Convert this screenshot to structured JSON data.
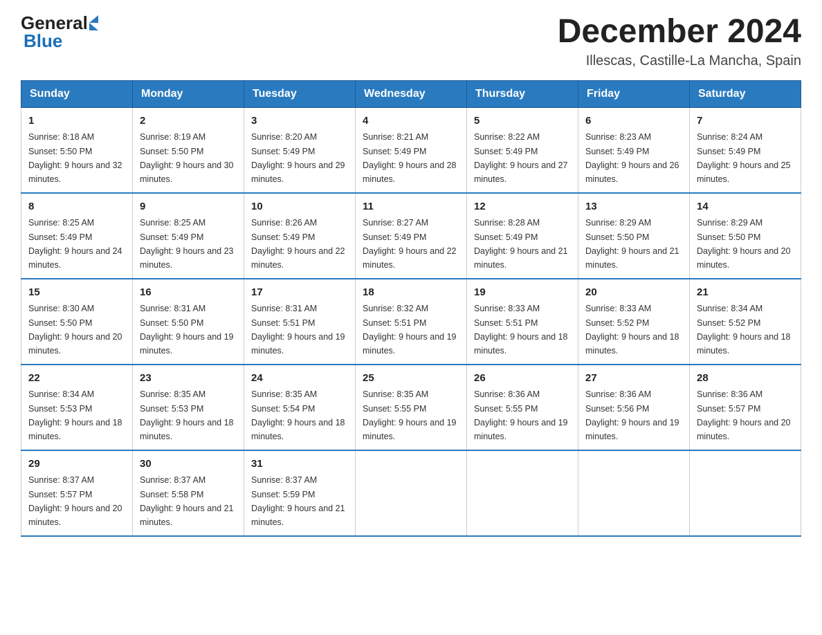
{
  "header": {
    "logo": {
      "text_general": "General",
      "text_blue": "Blue"
    },
    "title": "December 2024",
    "subtitle": "Illescas, Castille-La Mancha, Spain"
  },
  "days_of_week": [
    "Sunday",
    "Monday",
    "Tuesday",
    "Wednesday",
    "Thursday",
    "Friday",
    "Saturday"
  ],
  "weeks": [
    [
      {
        "day": "1",
        "sunrise": "8:18 AM",
        "sunset": "5:50 PM",
        "daylight": "9 hours and 32 minutes."
      },
      {
        "day": "2",
        "sunrise": "8:19 AM",
        "sunset": "5:50 PM",
        "daylight": "9 hours and 30 minutes."
      },
      {
        "day": "3",
        "sunrise": "8:20 AM",
        "sunset": "5:49 PM",
        "daylight": "9 hours and 29 minutes."
      },
      {
        "day": "4",
        "sunrise": "8:21 AM",
        "sunset": "5:49 PM",
        "daylight": "9 hours and 28 minutes."
      },
      {
        "day": "5",
        "sunrise": "8:22 AM",
        "sunset": "5:49 PM",
        "daylight": "9 hours and 27 minutes."
      },
      {
        "day": "6",
        "sunrise": "8:23 AM",
        "sunset": "5:49 PM",
        "daylight": "9 hours and 26 minutes."
      },
      {
        "day": "7",
        "sunrise": "8:24 AM",
        "sunset": "5:49 PM",
        "daylight": "9 hours and 25 minutes."
      }
    ],
    [
      {
        "day": "8",
        "sunrise": "8:25 AM",
        "sunset": "5:49 PM",
        "daylight": "9 hours and 24 minutes."
      },
      {
        "day": "9",
        "sunrise": "8:25 AM",
        "sunset": "5:49 PM",
        "daylight": "9 hours and 23 minutes."
      },
      {
        "day": "10",
        "sunrise": "8:26 AM",
        "sunset": "5:49 PM",
        "daylight": "9 hours and 22 minutes."
      },
      {
        "day": "11",
        "sunrise": "8:27 AM",
        "sunset": "5:49 PM",
        "daylight": "9 hours and 22 minutes."
      },
      {
        "day": "12",
        "sunrise": "8:28 AM",
        "sunset": "5:49 PM",
        "daylight": "9 hours and 21 minutes."
      },
      {
        "day": "13",
        "sunrise": "8:29 AM",
        "sunset": "5:50 PM",
        "daylight": "9 hours and 21 minutes."
      },
      {
        "day": "14",
        "sunrise": "8:29 AM",
        "sunset": "5:50 PM",
        "daylight": "9 hours and 20 minutes."
      }
    ],
    [
      {
        "day": "15",
        "sunrise": "8:30 AM",
        "sunset": "5:50 PM",
        "daylight": "9 hours and 20 minutes."
      },
      {
        "day": "16",
        "sunrise": "8:31 AM",
        "sunset": "5:50 PM",
        "daylight": "9 hours and 19 minutes."
      },
      {
        "day": "17",
        "sunrise": "8:31 AM",
        "sunset": "5:51 PM",
        "daylight": "9 hours and 19 minutes."
      },
      {
        "day": "18",
        "sunrise": "8:32 AM",
        "sunset": "5:51 PM",
        "daylight": "9 hours and 19 minutes."
      },
      {
        "day": "19",
        "sunrise": "8:33 AM",
        "sunset": "5:51 PM",
        "daylight": "9 hours and 18 minutes."
      },
      {
        "day": "20",
        "sunrise": "8:33 AM",
        "sunset": "5:52 PM",
        "daylight": "9 hours and 18 minutes."
      },
      {
        "day": "21",
        "sunrise": "8:34 AM",
        "sunset": "5:52 PM",
        "daylight": "9 hours and 18 minutes."
      }
    ],
    [
      {
        "day": "22",
        "sunrise": "8:34 AM",
        "sunset": "5:53 PM",
        "daylight": "9 hours and 18 minutes."
      },
      {
        "day": "23",
        "sunrise": "8:35 AM",
        "sunset": "5:53 PM",
        "daylight": "9 hours and 18 minutes."
      },
      {
        "day": "24",
        "sunrise": "8:35 AM",
        "sunset": "5:54 PM",
        "daylight": "9 hours and 18 minutes."
      },
      {
        "day": "25",
        "sunrise": "8:35 AM",
        "sunset": "5:55 PM",
        "daylight": "9 hours and 19 minutes."
      },
      {
        "day": "26",
        "sunrise": "8:36 AM",
        "sunset": "5:55 PM",
        "daylight": "9 hours and 19 minutes."
      },
      {
        "day": "27",
        "sunrise": "8:36 AM",
        "sunset": "5:56 PM",
        "daylight": "9 hours and 19 minutes."
      },
      {
        "day": "28",
        "sunrise": "8:36 AM",
        "sunset": "5:57 PM",
        "daylight": "9 hours and 20 minutes."
      }
    ],
    [
      {
        "day": "29",
        "sunrise": "8:37 AM",
        "sunset": "5:57 PM",
        "daylight": "9 hours and 20 minutes."
      },
      {
        "day": "30",
        "sunrise": "8:37 AM",
        "sunset": "5:58 PM",
        "daylight": "9 hours and 21 minutes."
      },
      {
        "day": "31",
        "sunrise": "8:37 AM",
        "sunset": "5:59 PM",
        "daylight": "9 hours and 21 minutes."
      },
      null,
      null,
      null,
      null
    ]
  ],
  "labels": {
    "sunrise": "Sunrise:",
    "sunset": "Sunset:",
    "daylight": "Daylight:"
  }
}
